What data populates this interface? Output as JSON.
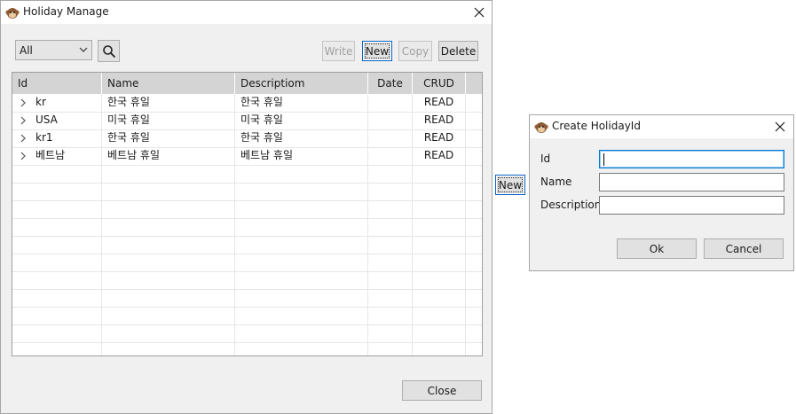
{
  "main_window": {
    "title": "Holiday Manage",
    "filter": {
      "selected": "All"
    },
    "toolbar": {
      "write_label": "Write",
      "new_label": "New",
      "copy_label": "Copy",
      "delete_label": "Delete"
    },
    "table": {
      "columns": [
        "Id",
        "Name",
        "Descriptiom",
        "Date",
        "CRUD"
      ],
      "rows": [
        {
          "id": "kr",
          "name": "한국 휴일",
          "description": "한국 휴일",
          "date": "",
          "crud": "READ"
        },
        {
          "id": "USA",
          "name": "미국 휴일",
          "description": "미국 휴일",
          "date": "",
          "crud": "READ"
        },
        {
          "id": "kr1",
          "name": "한국 휴일",
          "description": "한국 휴일",
          "date": "",
          "crud": "READ"
        },
        {
          "id": "베트남",
          "name": "베트남 휴일",
          "description": "베트남 휴일",
          "date": "",
          "crud": "READ"
        }
      ]
    },
    "close_label": "Close"
  },
  "floating_new_label": "New",
  "dialog": {
    "title": "Create HolidayId",
    "id_label": "Id",
    "name_label": "Name",
    "description_label": "Description",
    "id_value": "",
    "name_value": "",
    "description_value": "",
    "ok_label": "Ok",
    "cancel_label": "Cancel"
  }
}
